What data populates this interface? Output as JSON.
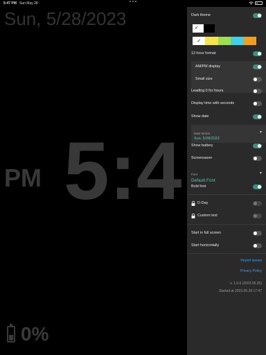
{
  "status_bar": {
    "time": "5:47 PM",
    "date": "Sun May 28"
  },
  "clock": {
    "date_text": "Sun, 5/28/2023",
    "ampm": "PM",
    "time_text": "5:4",
    "battery_text": "0%"
  },
  "settings": {
    "dark_theme": {
      "label": "Dark theme",
      "on": true
    },
    "bg_colors": [
      "#ffffff",
      "#000000"
    ],
    "fg_colors": [
      "#ffffff",
      "#f6e54a",
      "#9be04f",
      "#3fd0ea",
      "#f2a01c"
    ],
    "hour12": {
      "label": "12-hour format",
      "on": true
    },
    "ampm_display": {
      "label": "AM/PM display",
      "on": true
    },
    "small_size": {
      "label": "Small size",
      "on": false
    },
    "leading_zero": {
      "label": "Leading 0 for hours",
      "on": false
    },
    "display_seconds": {
      "label": "Display time with seconds",
      "on": false
    },
    "show_date": {
      "label": "Show date",
      "on": true
    },
    "date_format": {
      "label": "Date format",
      "value": "Sun, 5/28/2023"
    },
    "show_battery": {
      "label": "Show battery",
      "on": true
    },
    "screensaver": {
      "label": "Screensaver",
      "on": false
    },
    "font": {
      "label": "Font",
      "value": "Default Font"
    },
    "bold_font": {
      "label": "Bold font",
      "on": true
    },
    "dday": {
      "label": "D-Day"
    },
    "custom_text": {
      "label": "Custom text"
    },
    "start_fullscreen": {
      "label": "Start in full screen",
      "on": false
    },
    "start_horizontal": {
      "label": "Start horizontally",
      "on": false
    },
    "report_issues": "Report issues",
    "privacy_policy": "Privacy Policy",
    "version": "v. 1.9.6 (2023.05.26)",
    "started_at": "Started at 2023.05.28 17:47"
  }
}
